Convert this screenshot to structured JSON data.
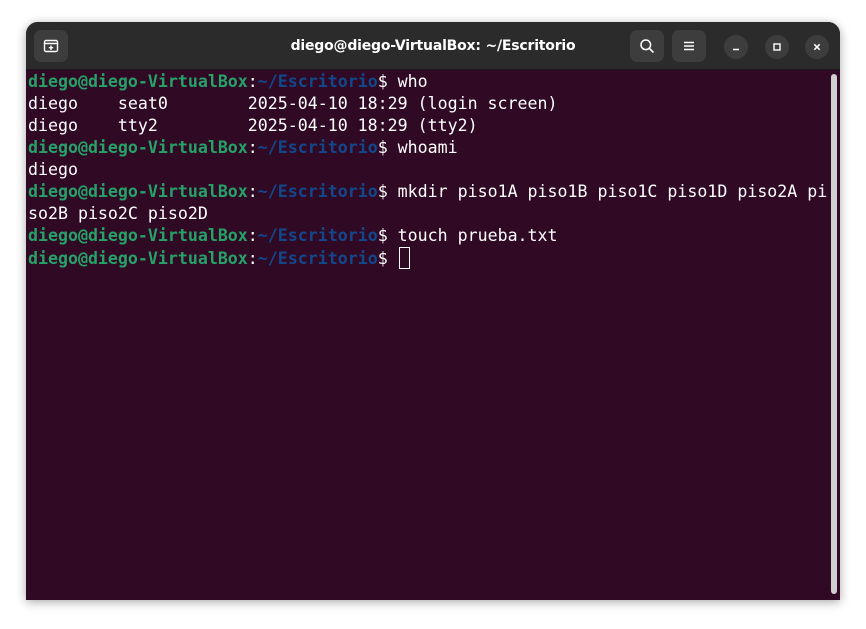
{
  "window": {
    "title": "diego@diego-VirtualBox: ~/Escritorio"
  },
  "icons": {
    "new_tab": "new-tab-icon",
    "search": "search-icon",
    "menu": "hamburger-menu-icon",
    "minimize": "minimize-icon",
    "maximize": "maximize-icon",
    "close": "close-icon"
  },
  "colors": {
    "terminal_bg": "#300a24",
    "prompt_user": "#26a269",
    "prompt_path": "#12488b",
    "titlebar_bg": "#2b2b2b"
  },
  "prompt": {
    "user_host": "diego@diego-VirtualBox",
    "colon": ":",
    "path": "~/Escritorio",
    "dollar": "$ "
  },
  "terminal": {
    "lines": [
      {
        "type": "cmd",
        "text": "who"
      },
      {
        "type": "out",
        "text": "diego    seat0        2025-04-10 18:29 (login screen)"
      },
      {
        "type": "out",
        "text": "diego    tty2         2025-04-10 18:29 (tty2)"
      },
      {
        "type": "cmd",
        "text": "whoami"
      },
      {
        "type": "out",
        "text": "diego"
      },
      {
        "type": "cmd",
        "text": "mkdir piso1A piso1B piso1C piso1D piso2A pi"
      },
      {
        "type": "out",
        "text": "so2B piso2C piso2D"
      },
      {
        "type": "cmd",
        "text": "touch prueba.txt"
      },
      {
        "type": "cmd",
        "text": ""
      }
    ]
  }
}
